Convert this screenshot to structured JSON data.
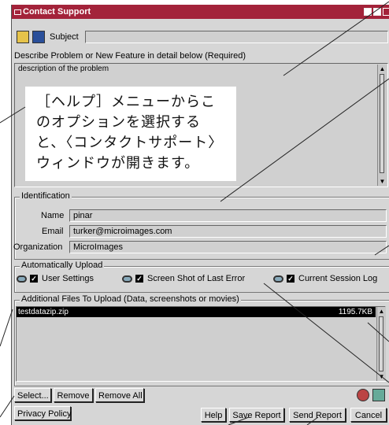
{
  "window": {
    "title": "Contact Support"
  },
  "toolbar": {
    "subject_label": "Subject",
    "subject_value": ""
  },
  "describe": {
    "label": "Describe Problem or New Feature in detail below (Required)",
    "text": "description of the problem"
  },
  "callout": {
    "text": "［ヘルプ］メニューからこのオプションを選択すると、〈コンタクトサポート〉ウィンドウが開きます。"
  },
  "identification": {
    "group_label": "Identification",
    "name_label": "Name",
    "name_value": "pinar",
    "email_label": "Email",
    "email_value": "turker@microimages.com",
    "org_label": "Organization",
    "org_value": "MicroImages"
  },
  "auto_upload": {
    "group_label": "Automatically Upload",
    "items": [
      {
        "label": "User Settings",
        "checked": true
      },
      {
        "label": "Screen Shot of Last Error",
        "checked": true
      },
      {
        "label": "Current Session Log",
        "checked": true
      }
    ]
  },
  "additional_files": {
    "group_label": "Additional Files To Upload (Data, screenshots or movies)",
    "files": [
      {
        "name": "testdatazip.zip",
        "size": "1195.7KB"
      }
    ],
    "select_label": "Select...",
    "remove_label": "Remove",
    "remove_all_label": "Remove All"
  },
  "footer": {
    "privacy_label": "Privacy Policy",
    "help_label": "Help",
    "save_label": "Save Report",
    "send_label": "Send Report",
    "cancel_label": "Cancel"
  },
  "colors": {
    "titlebar": "#a3233a",
    "window_bg": "#d6d6d6",
    "selection": "#000000"
  }
}
